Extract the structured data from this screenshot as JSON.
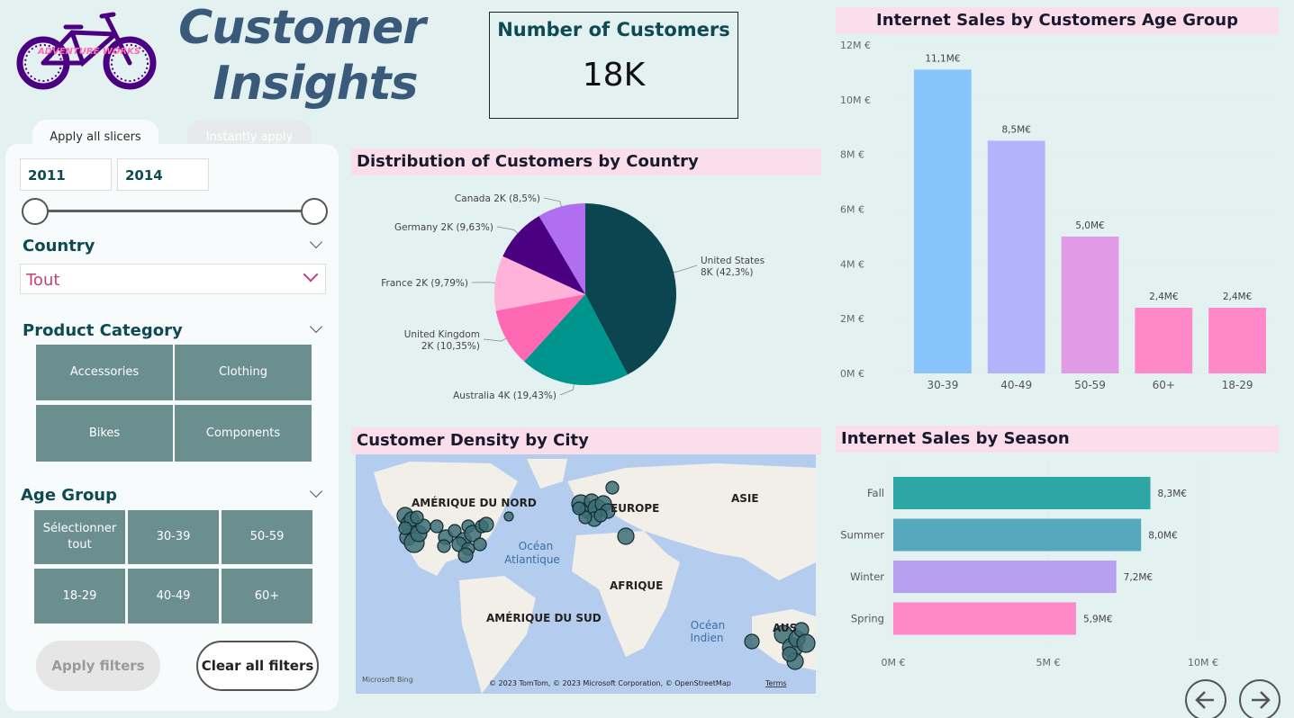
{
  "logo": {
    "brand_text": "ADVENTURE WORKS"
  },
  "title": {
    "line1": "Customer",
    "line2": "Insights"
  },
  "kpi": {
    "title": "Number of Customers",
    "value": "18K"
  },
  "tabs": {
    "apply_all": "Apply all slicers",
    "instantly": "Instantly apply"
  },
  "slicers": {
    "year_from": "2011",
    "year_to": "2014",
    "country": {
      "label": "Country",
      "selected": "Tout"
    },
    "product_category": {
      "label": "Product Category",
      "options": [
        "Accessories",
        "Clothing",
        "Bikes",
        "Components"
      ]
    },
    "age_group": {
      "label": "Age Group",
      "options": [
        "Sélectionner tout",
        "30-39",
        "50-59",
        "18-29",
        "40-49",
        "60+"
      ]
    }
  },
  "buttons": {
    "apply_filters": "Apply filters",
    "clear_filters": "Clear all filters"
  },
  "sections": {
    "pie_title": "Distribution of Customers by Country",
    "map_title": "Customer Density by City",
    "age_title": "Internet Sales by Customers Age Group",
    "season_title": "Internet Sales by Season"
  },
  "map": {
    "labels": [
      "AMÉRIQUE DU NORD",
      "EUROPE",
      "ASIE",
      "AFRIQUE",
      "AMÉRIQUE DU SUD",
      "AUS"
    ],
    "oceans": [
      "Océan\nAtlantique",
      "Océan\nIndien"
    ],
    "bing": "Microsoft Bing",
    "attribution": "© 2023 TomTom, © 2023 Microsoft Corporation, © OpenStreetMap",
    "terms": "Terms"
  },
  "colors": {
    "pie": [
      "#0b4550",
      "#00948f",
      "#ff69b4",
      "#ffb3d9",
      "#4b0082",
      "#b06ef0"
    ],
    "age": [
      "#87c4fc",
      "#b3b3fc",
      "#e09ae6",
      "#ff88c8",
      "#ff88c8"
    ],
    "season": [
      "#2fa6a6",
      "#55a8bd",
      "#b8a0f0",
      "#ff88c8"
    ]
  },
  "chart_data": [
    {
      "type": "pie",
      "title": "Distribution of Customers by Country",
      "slices": [
        {
          "label": "United States",
          "value_label": "8K",
          "percent": 42.3,
          "text": "United States\n8K (42,3%)"
        },
        {
          "label": "Australia",
          "value_label": "4K",
          "percent": 19.43,
          "text": "Australia 4K (19,43%)"
        },
        {
          "label": "United Kingdom",
          "value_label": "2K",
          "percent": 10.35,
          "text": "United Kingdom\n2K (10,35%)"
        },
        {
          "label": "France",
          "value_label": "2K",
          "percent": 9.79,
          "text": "France 2K (9,79%)"
        },
        {
          "label": "Germany",
          "value_label": "2K",
          "percent": 9.63,
          "text": "Germany 2K (9,63%)"
        },
        {
          "label": "Canada",
          "value_label": "2K",
          "percent": 8.5,
          "text": "Canada 2K (8,5%)"
        }
      ]
    },
    {
      "type": "bar",
      "title": "Internet Sales by Customers Age Group",
      "categories": [
        "30-39",
        "40-49",
        "50-59",
        "60+",
        "18-29"
      ],
      "values": [
        11.1,
        8.5,
        5.0,
        2.4,
        2.4
      ],
      "data_labels": [
        "11,1M€",
        "8,5M€",
        "5,0M€",
        "2,4M€",
        "2,4M€"
      ],
      "yticks": [
        "0M €",
        "2M €",
        "4M €",
        "6M €",
        "8M €",
        "10M €",
        "12M €"
      ],
      "ylim": [
        0,
        12
      ]
    },
    {
      "type": "bar",
      "orientation": "horizontal",
      "title": "Internet Sales by Season",
      "categories": [
        "Fall",
        "Summer",
        "Winter",
        "Spring"
      ],
      "values": [
        8.3,
        8.0,
        7.2,
        5.9
      ],
      "data_labels": [
        "8,3M€",
        "8,0M€",
        "7,2M€",
        "5,9M€"
      ],
      "xticks": [
        "0M €",
        "5M €",
        "10M €"
      ],
      "xlim": [
        0,
        10
      ]
    }
  ]
}
